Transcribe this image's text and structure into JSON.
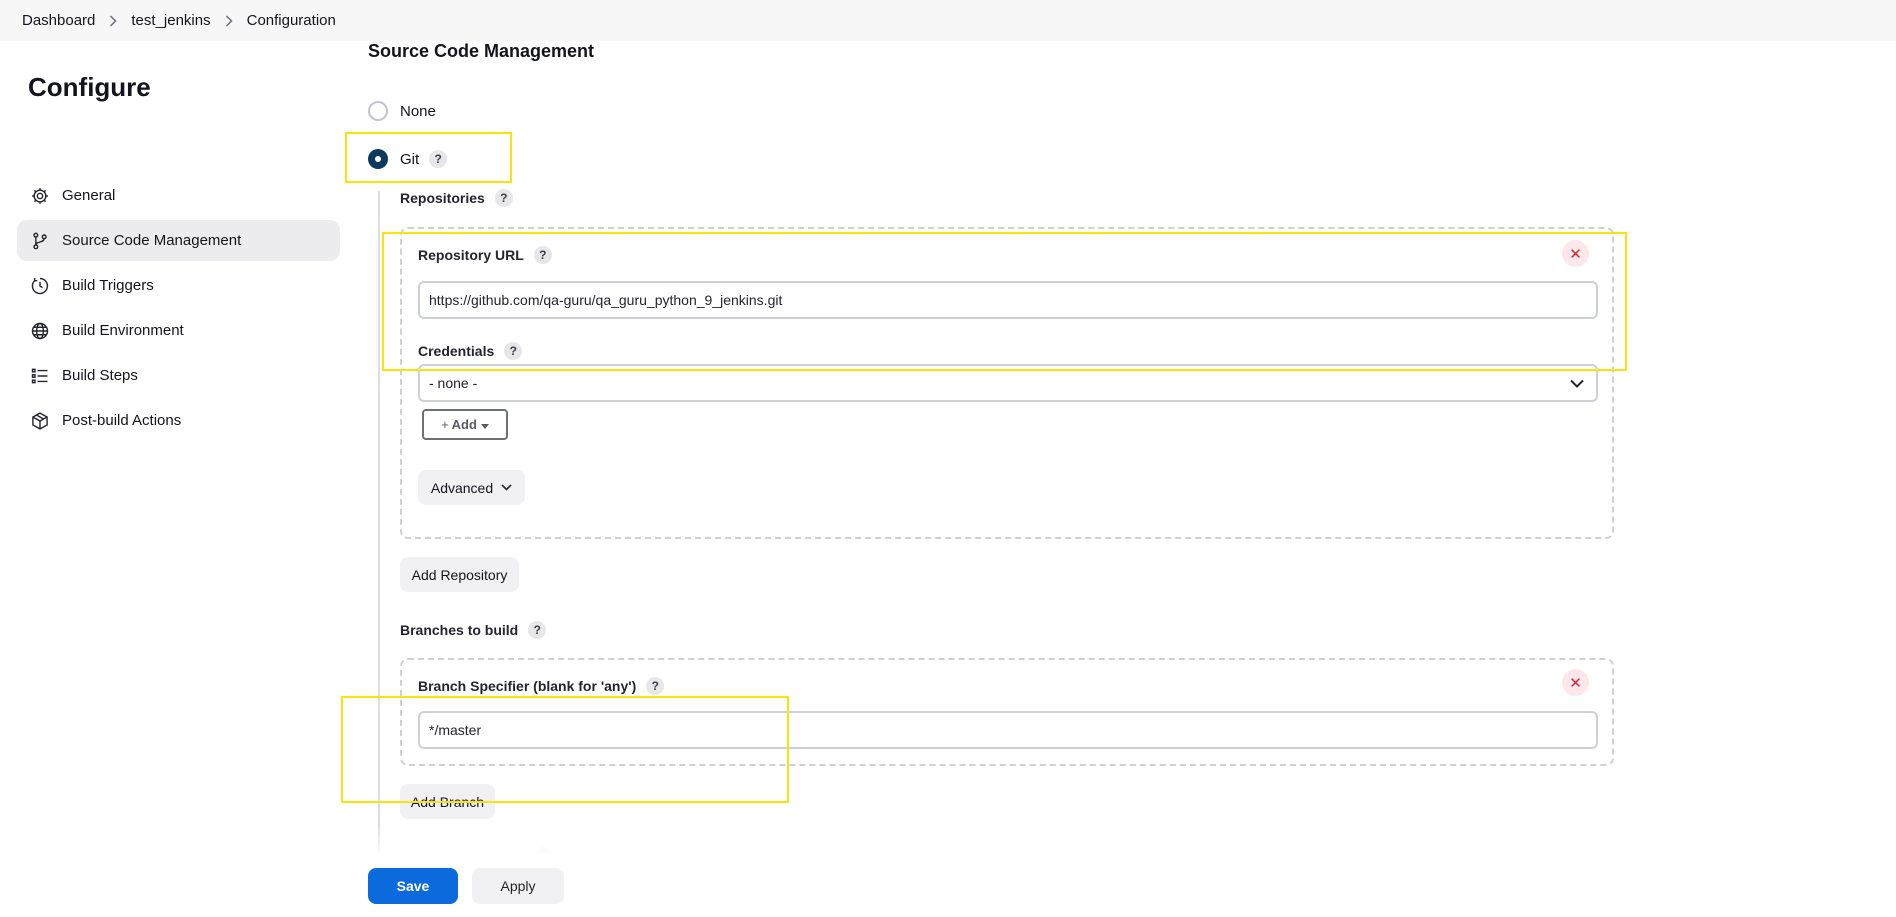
{
  "breadcrumb": [
    "Dashboard",
    "test_jenkins",
    "Configuration"
  ],
  "sidebar": {
    "title": "Configure",
    "items": [
      {
        "label": "General",
        "icon": "gear-icon",
        "active": false
      },
      {
        "label": "Source Code Management",
        "icon": "git-branch-icon",
        "active": true
      },
      {
        "label": "Build Triggers",
        "icon": "clock-icon",
        "active": false
      },
      {
        "label": "Build Environment",
        "icon": "globe-icon",
        "active": false
      },
      {
        "label": "Build Steps",
        "icon": "list-icon",
        "active": false
      },
      {
        "label": "Post-build Actions",
        "icon": "package-icon",
        "active": false
      }
    ]
  },
  "scm": {
    "title": "Source Code Management",
    "options": [
      {
        "label": "None",
        "selected": false
      },
      {
        "label": "Git",
        "selected": true
      }
    ],
    "help_glyph": "?",
    "repositories_label": "Repositories",
    "repository_url_label": "Repository URL",
    "repository_url_value": "https://github.com/qa-guru/qa_guru_python_9_jenkins.git",
    "credentials_label": "Credentials",
    "credentials_value": "- none -",
    "add_label": "Add",
    "advanced_label": "Advanced",
    "add_repository_label": "Add Repository",
    "branches_label": "Branches to build",
    "branch_specifier_label": "Branch Specifier (blank for 'any')",
    "branch_specifier_value": "*/master",
    "add_branch_label": "Add Branch",
    "close_glyph": "✕"
  },
  "footer": {
    "save_label": "Save",
    "apply_label": "Apply"
  },
  "colors": {
    "accent": "#0b6bdc",
    "highlight": "#f7e40a",
    "selected_radio": "#0b3a5e",
    "remove": "#d6283b"
  }
}
